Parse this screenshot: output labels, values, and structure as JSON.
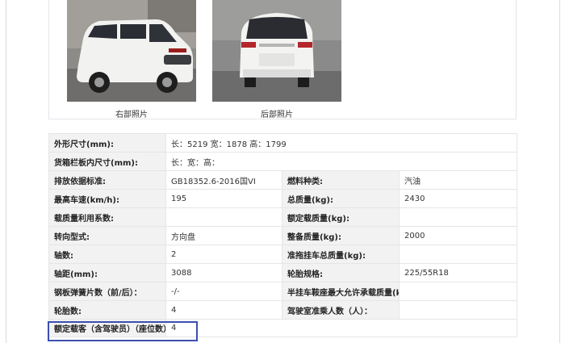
{
  "photos": {
    "right_caption": "右部照片",
    "rear_caption": "后部照片"
  },
  "specs": {
    "row1": {
      "label": "外形尺寸(mm):",
      "value": "长：5219 宽：1878 高：1799"
    },
    "row2": {
      "label": "货箱栏板内尺寸(mm):",
      "value": "长：宽：高："
    },
    "row3": {
      "l1": "排放依据标准:",
      "v1": "GB18352.6-2016国VI",
      "l2": "燃料种类:",
      "v2": "汽油"
    },
    "row4": {
      "l1": "最高车速(km/h):",
      "v1": "195",
      "l2": "总质量(kg):",
      "v2": "2430"
    },
    "row5": {
      "l1": "载质量利用系数:",
      "v1": "",
      "l2": "额定载质量(kg):",
      "v2": ""
    },
    "row6": {
      "l1": "转向型式:",
      "v1": "方向盘",
      "l2": "整备质量(kg):",
      "v2": "2000"
    },
    "row7": {
      "l1": "轴数:",
      "v1": "2",
      "l2": "准拖挂车总质量(kg):",
      "v2": ""
    },
    "row8": {
      "l1": "轴距(mm):",
      "v1": "3088",
      "l2": "轮胎规格:",
      "v2": "225/55R18"
    },
    "row9": {
      "l1": "钢板弹簧片数（前/后）：",
      "v1": "-/-",
      "l2": "半挂车鞍座最大允许承载质量(kg):",
      "v2": ""
    },
    "row10": {
      "l1": "轮胎数:",
      "v1": "4",
      "l2": "驾驶室准乘人数（人）：",
      "v2": ""
    },
    "row11": {
      "label": "额定载客（含驾驶员）（座位数）：",
      "value": "4"
    }
  },
  "colors": {
    "highlight_border": "#3b4fb0",
    "label_bg": "#f2f2f2"
  }
}
